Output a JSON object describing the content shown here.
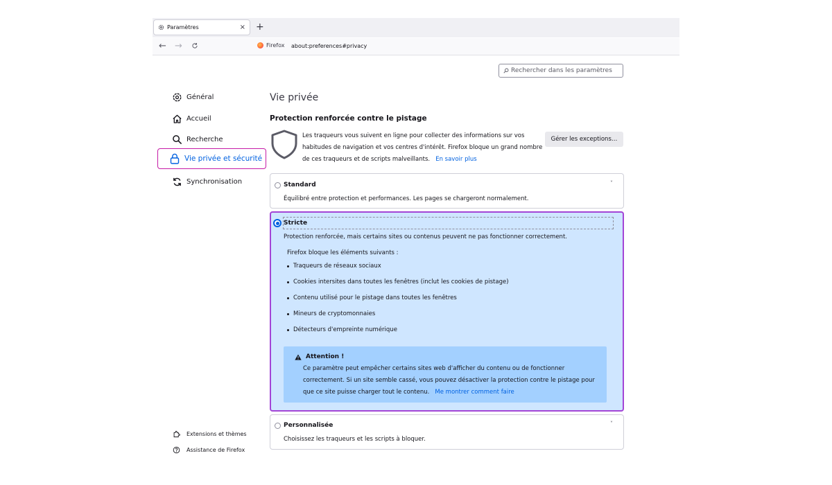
{
  "tab": {
    "title": "Paramètres",
    "close": "×",
    "new_tab": "+"
  },
  "toolbar": {
    "back": "←",
    "forward": "→",
    "reload": "C"
  },
  "urlbar": {
    "identity": "Firefox",
    "url": "about:preferences#privacy"
  },
  "search": {
    "placeholder": "Rechercher dans les paramètres"
  },
  "sidebar": {
    "items": [
      {
        "label": "Général",
        "icon": "gear-icon"
      },
      {
        "label": "Accueil",
        "icon": "home-icon"
      },
      {
        "label": "Recherche",
        "icon": "search-icon"
      },
      {
        "label": "Vie privée et sécurité",
        "icon": "lock-icon",
        "selected": true
      },
      {
        "label": "Synchronisation",
        "icon": "sync-icon"
      }
    ],
    "footer": [
      {
        "label": "Extensions et thèmes",
        "icon": "puzzle-icon"
      },
      {
        "label": "Assistance de Firefox",
        "icon": "help-icon"
      }
    ]
  },
  "main": {
    "page_title": "Vie privée",
    "section_title": "Protection renforcée contre le pistage",
    "description_lines": [
      "Les traqueurs vous suivent en ligne pour collecter des informations sur vos",
      "habitudes de navigation et vos centres d'intérêt. Firefox bloque un grand nombre",
      "de ces traqueurs et de scripts malveillants."
    ],
    "learn_more": "En savoir plus",
    "exceptions_button": "Gérer les exceptions…",
    "options": {
      "standard": {
        "label": "Standard",
        "desc": "Équilibré entre protection et performances. Les pages se chargeront normalement.",
        "selected": false
      },
      "strict": {
        "label": "Stricte",
        "desc": "Protection renforcée, mais certains sites ou contenus peuvent ne pas fonctionner correctement.",
        "blocks_heading": "Firefox bloque les éléments suivants :",
        "blocks": [
          "Traqueurs de réseaux sociaux",
          "Cookies intersites dans toutes les fenêtres (inclut les cookies de pistage)",
          "Contenu utilisé pour le pistage dans toutes les fenêtres",
          "Mineurs de cryptomonnaies",
          "Détecteurs d'empreinte numérique"
        ],
        "warning": {
          "title": "Attention !",
          "lines": [
            "Ce paramètre peut empêcher certains sites web d'afficher du contenu ou de fonctionner",
            "correctement. Si un site semble cassé, vous pouvez désactiver la protection contre le pistage pour",
            "que ce site puisse charger tout le contenu."
          ],
          "link": "Me montrer comment faire"
        },
        "selected": true
      },
      "custom": {
        "label": "Personnalisée",
        "desc": "Choisissez les traqueurs et les scripts à bloquer.",
        "selected": false
      }
    },
    "chevron": "˅"
  },
  "colors": {
    "accent": "#0061e0",
    "selection_ring": "#c51aa6",
    "strict_bg": "#cfe6ff",
    "warning_bg": "#a3d0ff"
  }
}
